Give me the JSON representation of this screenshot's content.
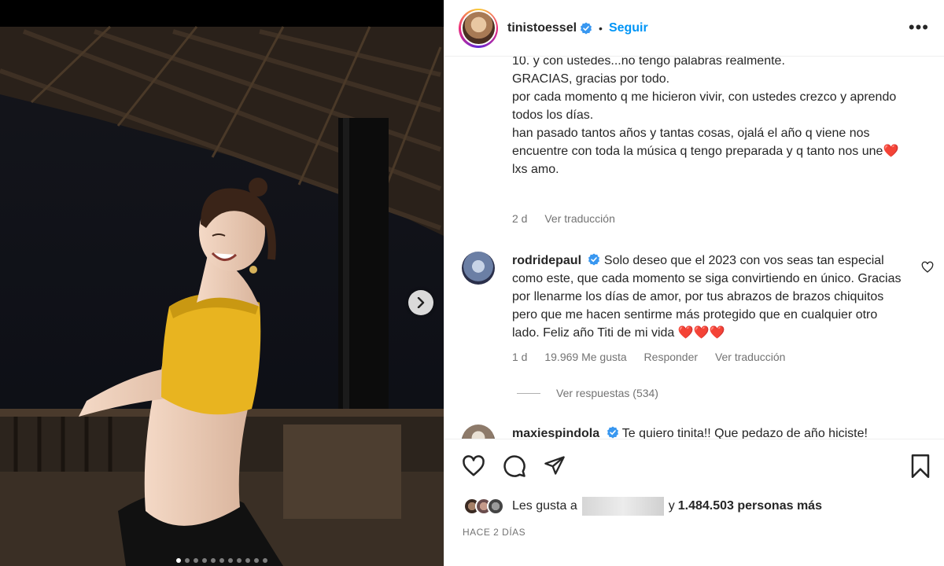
{
  "post": {
    "username": "tinistoessel",
    "follow_label": "Seguir",
    "separator": "•",
    "more_label": "•••",
    "caption_lines": "10. y con ustedes...no tengo palabras realmente.\nGRACIAS, gracias por todo.\npor cada momento q me hicieron vivir, con ustedes crezco y aprendo todos los días.\nhan pasado tantos años y tantas cosas, ojalá el año q viene nos encuentre con toda la música q tengo preparada y q tanto nos une❤️\nlxs amo.",
    "caption_time": "2 d",
    "caption_translate": "Ver traducción",
    "likes_prefix": "Les gusta a",
    "likes_joiner": "y",
    "likes_count": "1.484.503 personas más",
    "time_ago": "HACE 2 DÍAS",
    "carousel_total": 11,
    "carousel_active": 1
  },
  "comments": [
    {
      "username": "rodridepaul",
      "text": "Solo deseo que el 2023 con vos seas tan especial como este, que cada momento se siga convirtiendo en único. Gracias por llenarme los días de amor, por tus abrazos de brazos chiquitos pero que me hacen sentirme más protegido que en cualquier otro lado. Feliz año Titi de mi vida ❤️❤️❤️",
      "time": "1 d",
      "likes": "19.969 Me gusta",
      "reply": "Responder",
      "translate": "Ver traducción",
      "view_replies": "Ver respuestas (534)"
    },
    {
      "username": "maxiespindola",
      "text": "Te quiero tinita!! Que pedazo de año hiciste!"
    }
  ],
  "icons": {
    "verified": "verified-badge-icon",
    "like": "heart-icon",
    "comment": "comment-icon",
    "share": "share-icon",
    "save": "bookmark-icon",
    "next": "chevron-right-icon"
  },
  "colors": {
    "accent": "#0095f6",
    "verified": "#3897f0",
    "heart": "#ed4956",
    "muted": "#737373"
  }
}
